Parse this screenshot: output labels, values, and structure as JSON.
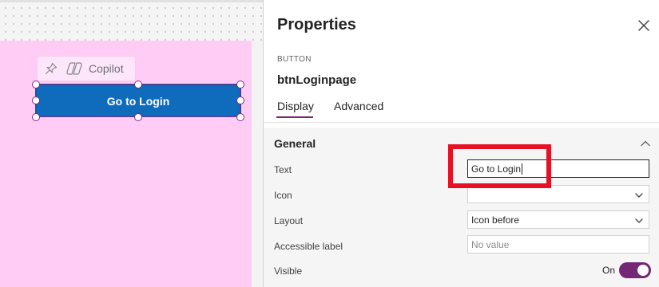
{
  "canvas": {
    "copilot_label": "Copilot",
    "button_text": "Go to Login",
    "screen_color": "#ffccf5",
    "button_color": "#0f6cbd"
  },
  "properties": {
    "title": "Properties",
    "control_type": "BUTTON",
    "control_name": "btnLoginpage",
    "tabs": [
      {
        "label": "Display",
        "selected": true
      },
      {
        "label": "Advanced",
        "selected": false
      }
    ],
    "group": {
      "title": "General",
      "expanded": true,
      "rows": [
        {
          "label": "Text",
          "value": "Go to Login",
          "type": "text-input",
          "focused": true
        },
        {
          "label": "Icon",
          "value": "",
          "type": "dropdown"
        },
        {
          "label": "Layout",
          "value": "Icon before",
          "type": "dropdown"
        },
        {
          "label": "Accessible label",
          "placeholder": "No value",
          "type": "text-input"
        },
        {
          "label": "Visible",
          "toggle_text": "On",
          "toggle_on": true,
          "type": "toggle"
        }
      ]
    },
    "accent_color": "#742774",
    "highlight_color": "#e81123"
  }
}
